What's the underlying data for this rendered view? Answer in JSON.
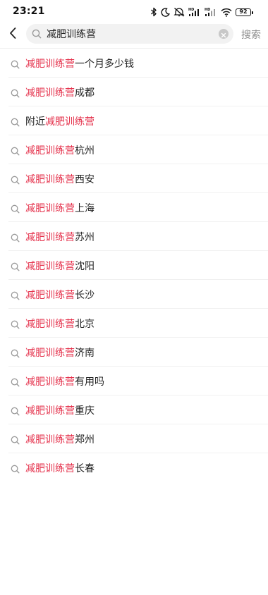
{
  "status_bar": {
    "time": "23:21",
    "icons": [
      "bluetooth-icon",
      "moon-icon",
      "mute-icon",
      "hd-signal-icon",
      "hd-signal-icon",
      "wifi-icon",
      "battery-icon"
    ],
    "battery_level": "92"
  },
  "header": {
    "back_icon": "chevron-left-icon",
    "search_icon": "search-icon",
    "search_value": "减肥训练营",
    "clear_icon": "clear-icon",
    "search_button_label": "搜索"
  },
  "colors": {
    "highlight": "#e5334d",
    "text": "#222222",
    "muted": "#8e8e8e"
  },
  "suggestions": [
    {
      "before": "",
      "match": "减肥训练营",
      "after": "一个月多少钱"
    },
    {
      "before": "",
      "match": "减肥训练营",
      "after": "成都"
    },
    {
      "before": "附近",
      "match": "减肥训练营",
      "after": ""
    },
    {
      "before": "",
      "match": "减肥训练营",
      "after": "杭州"
    },
    {
      "before": "",
      "match": "减肥训练营",
      "after": "西安"
    },
    {
      "before": "",
      "match": "减肥训练营",
      "after": "上海"
    },
    {
      "before": "",
      "match": "减肥训练营",
      "after": "苏州"
    },
    {
      "before": "",
      "match": "减肥训练营",
      "after": "沈阳"
    },
    {
      "before": "",
      "match": "减肥训练营",
      "after": "长沙"
    },
    {
      "before": "",
      "match": "减肥训练营",
      "after": "北京"
    },
    {
      "before": "",
      "match": "减肥训练营",
      "after": "济南"
    },
    {
      "before": "",
      "match": "减肥训练营",
      "after": "有用吗"
    },
    {
      "before": "",
      "match": "减肥训练营",
      "after": "重庆"
    },
    {
      "before": "",
      "match": "减肥训练营",
      "after": "郑州"
    },
    {
      "before": "",
      "match": "减肥训练营",
      "after": "长春"
    }
  ]
}
